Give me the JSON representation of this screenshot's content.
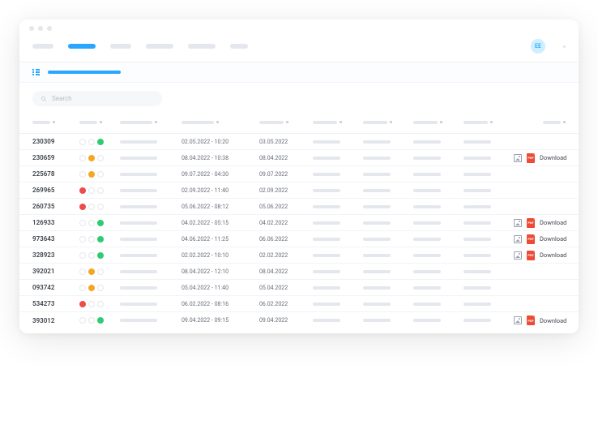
{
  "avatar": "EE",
  "search": {
    "placeholder": "Search"
  },
  "pdf_label": "PDF",
  "download_label": "Download",
  "rows": [
    {
      "id": "230309",
      "status": [
        "",
        "",
        "green"
      ],
      "dt": "02.05.2022 - 10:20",
      "d2": "03.05.2022",
      "dl": false
    },
    {
      "id": "230659",
      "status": [
        "",
        "orange",
        ""
      ],
      "dt": "08.04.2022 - 10:38",
      "d2": "08.04.2022",
      "dl": true
    },
    {
      "id": "225678",
      "status": [
        "",
        "orange",
        ""
      ],
      "dt": "09.07.2022 - 04:30",
      "d2": "09.07.2022",
      "dl": false
    },
    {
      "id": "269965",
      "status": [
        "red",
        "",
        ""
      ],
      "dt": "02.09.2022 - 11:40",
      "d2": "02.09.2022",
      "dl": false
    },
    {
      "id": "260735",
      "status": [
        "red",
        "",
        ""
      ],
      "dt": "05.06.2022 - 08:12",
      "d2": "05.06.2022",
      "dl": false
    },
    {
      "id": "126933",
      "status": [
        "",
        "",
        "green"
      ],
      "dt": "04.02.2022 - 05:15",
      "d2": "04.02.2022",
      "dl": true
    },
    {
      "id": "973643",
      "status": [
        "",
        "",
        "green"
      ],
      "dt": "04.06.2022 - 11:25",
      "d2": "06.06.2022",
      "dl": true
    },
    {
      "id": "328923",
      "status": [
        "",
        "",
        "green"
      ],
      "dt": "02.02.2022 - 10:10",
      "d2": "02.02.2022",
      "dl": true
    },
    {
      "id": "392021",
      "status": [
        "",
        "orange",
        ""
      ],
      "dt": "08.04.2022 - 12:10",
      "d2": "08.04.2022",
      "dl": false
    },
    {
      "id": "093742",
      "status": [
        "",
        "orange",
        ""
      ],
      "dt": "05.04.2022 - 11:40",
      "d2": "05.04.2022",
      "dl": false
    },
    {
      "id": "534273",
      "status": [
        "red",
        "",
        ""
      ],
      "dt": "06.02.2022 - 08:16",
      "d2": "06.02.2022",
      "dl": false
    },
    {
      "id": "393012",
      "status": [
        "",
        "",
        "green"
      ],
      "dt": "09.04.2022 - 09:15",
      "d2": "09.04.2022",
      "dl": true
    }
  ]
}
